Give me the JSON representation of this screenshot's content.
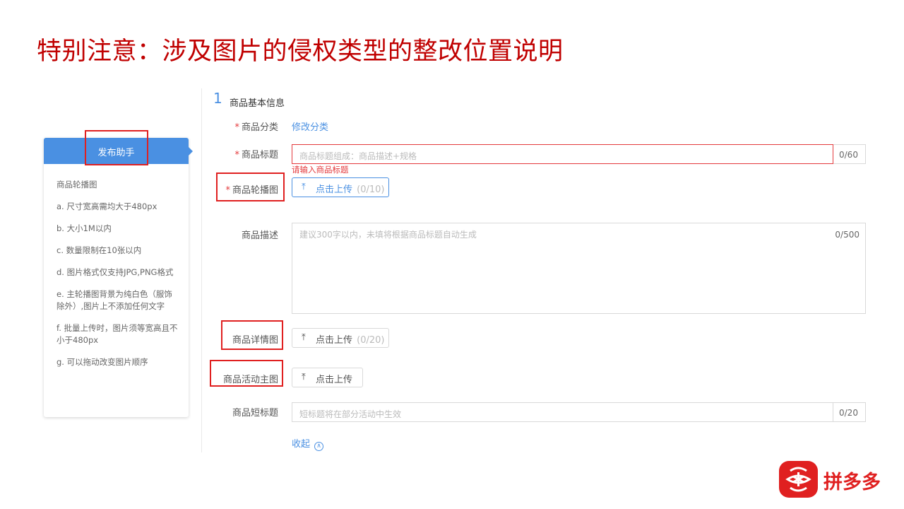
{
  "slide": {
    "title": "特别注意：涉及图片的侵权类型的整改位置说明"
  },
  "helper": {
    "title": "发布助手",
    "lines": [
      "商品轮播图",
      "a. 尺寸宽高需均大于480px",
      "b. 大小1M以内",
      "c. 数量限制在10张以内",
      "d. 图片格式仅支持JPG,PNG格式",
      "e. 主轮播图背景为纯白色（服饰除外）,图片上不添加任何文字",
      "f. 批量上传时，图片须等宽高且不小于480px",
      "g. 可以拖动改变图片顺序"
    ]
  },
  "section": {
    "number": "1",
    "title": "商品基本信息"
  },
  "form": {
    "category": {
      "label": "商品分类",
      "link": "修改分类"
    },
    "title": {
      "label": "商品标题",
      "placeholder": "商品标题组成：商品描述+规格",
      "counter": "0/60",
      "error": "请输入商品标题"
    },
    "carousel": {
      "label": "商品轮播图",
      "upload": "点击上传",
      "count": "(0/10)"
    },
    "description": {
      "label": "商品描述",
      "placeholder": "建议300字以内，未填将根据商品标题自动生成",
      "counter": "0/500"
    },
    "detail": {
      "label": "商品详情图",
      "upload": "点击上传",
      "count": "(0/20)"
    },
    "activity": {
      "label": "商品活动主图",
      "upload": "点击上传"
    },
    "short_title": {
      "label": "商品短标题",
      "placeholder": "短标题将在部分活动中生效",
      "counter": "0/20"
    },
    "collapse": "收起"
  },
  "brand": {
    "name": "拼多多",
    "color": "#e02020"
  },
  "icons": {
    "upload": "upload-icon",
    "collapse": "chevron-up-circle-icon",
    "logo": "pinduoduo-logo-icon"
  },
  "colors": {
    "title": "#c00000",
    "accent": "#4a90e2",
    "error": "#e4393c",
    "highlight": "#e02020"
  }
}
